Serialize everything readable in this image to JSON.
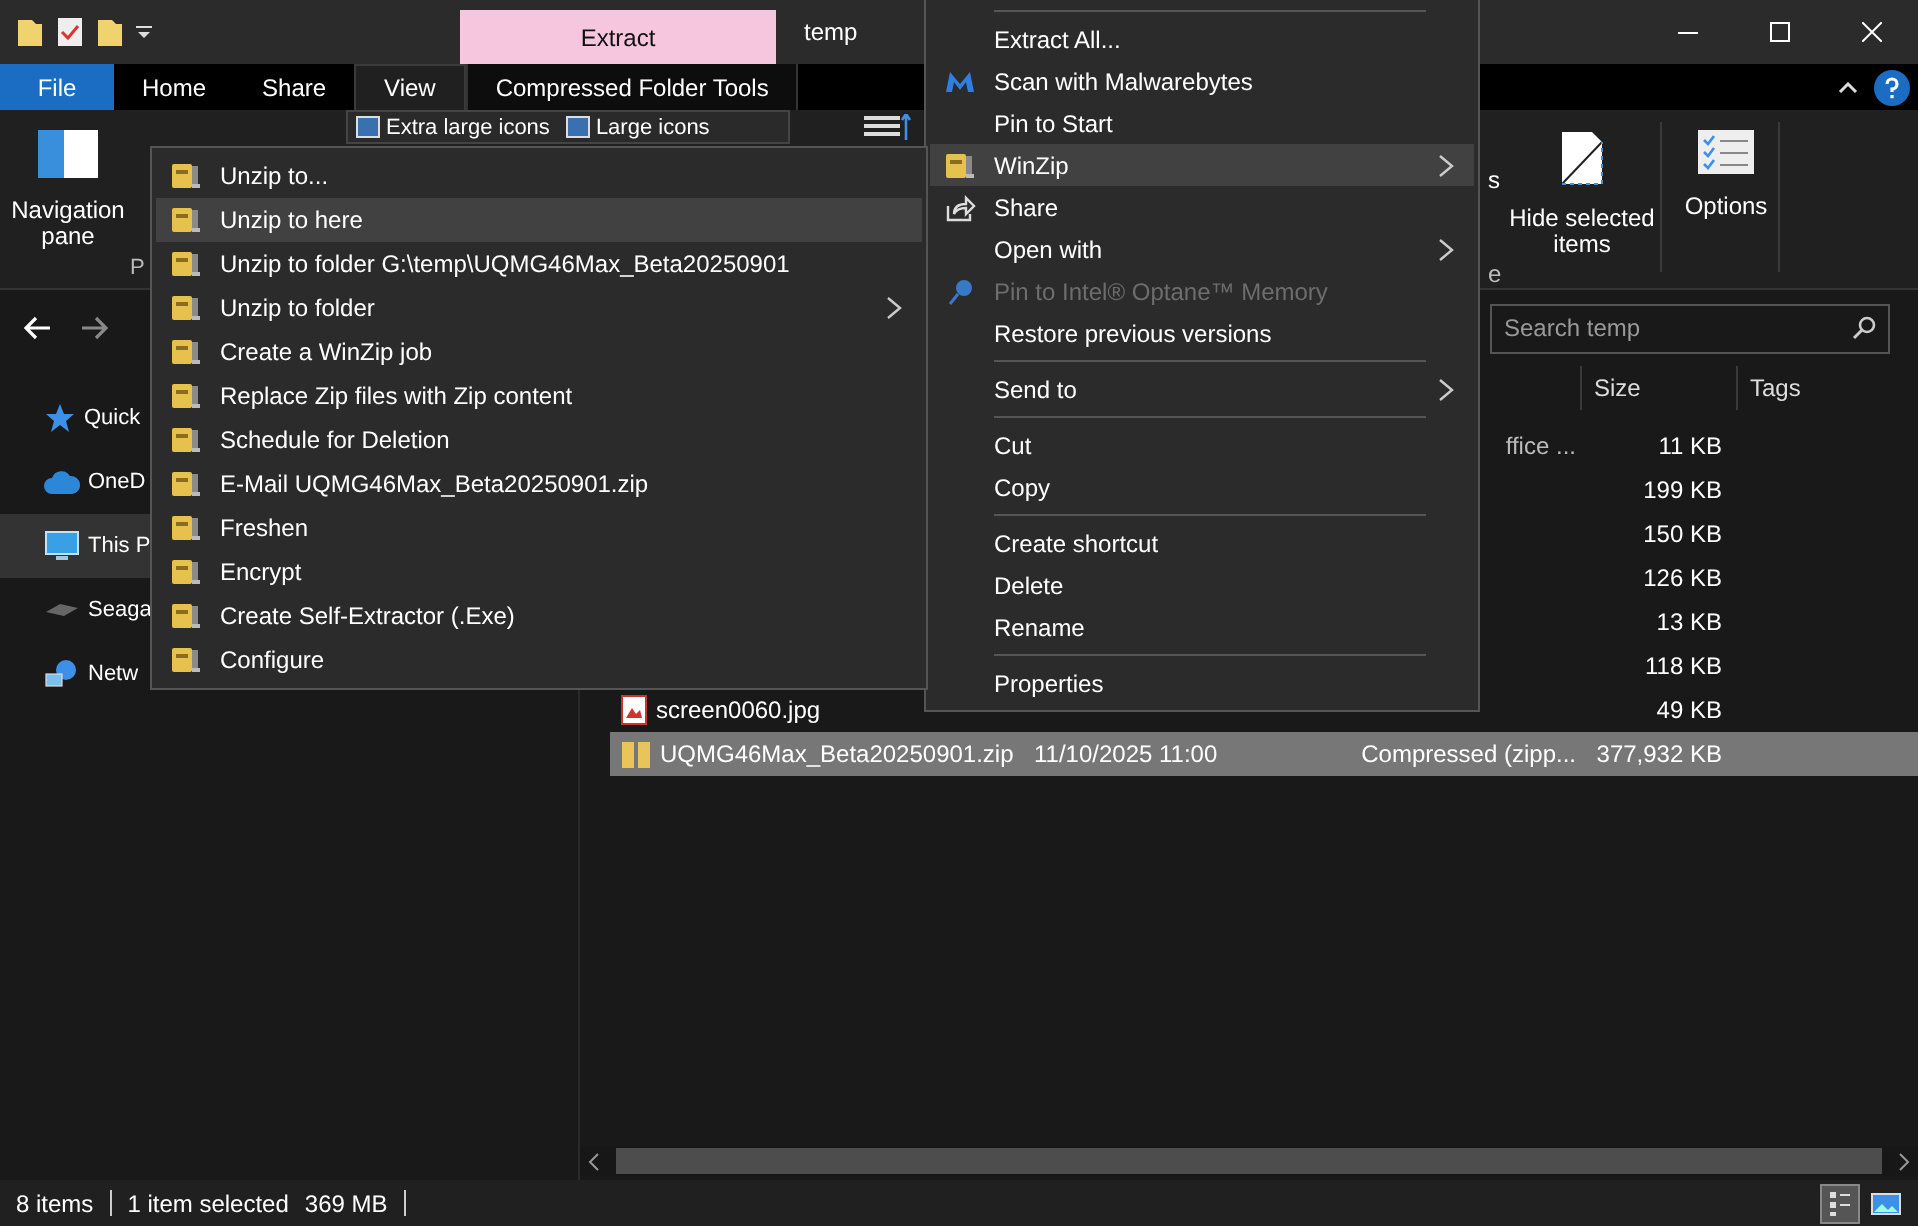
{
  "title_bar": {
    "context_tab": "Extract",
    "title": "temp"
  },
  "ribbon_tabs": [
    {
      "label": "File",
      "kind": "file",
      "selected": false
    },
    {
      "label": "Home",
      "kind": "plain",
      "selected": false
    },
    {
      "label": "Share",
      "kind": "plain",
      "selected": false
    },
    {
      "label": "View",
      "kind": "plain",
      "selected": true
    },
    {
      "label": "Compressed Folder Tools",
      "kind": "context",
      "selected": false
    }
  ],
  "ribbon": {
    "navigation_pane": "Navigation pane",
    "panes_group_label": "P",
    "layout_options": [
      "Extra large icons",
      "Large icons"
    ],
    "show_hide_option_fragment": "s",
    "show_hide_group_label": "e",
    "hide_selected": "Hide selected items",
    "options": "Options"
  },
  "search": {
    "placeholder": "Search temp"
  },
  "navigation": [
    {
      "label": "Quick",
      "kind": "star",
      "selected": false
    },
    {
      "label": "OneD",
      "kind": "cloud",
      "selected": false
    },
    {
      "label": "This P",
      "kind": "pc",
      "selected": true
    },
    {
      "label": "Seaga",
      "kind": "drive",
      "selected": false
    },
    {
      "label": "Netw",
      "kind": "network",
      "selected": false
    }
  ],
  "file_list": {
    "columns": [
      "Size",
      "Tags"
    ],
    "rows": [
      {
        "kind": "hidden",
        "type": "ffice ...",
        "size": "11 KB",
        "selected": false
      },
      {
        "kind": "hidden",
        "size": "199 KB",
        "selected": false
      },
      {
        "kind": "hidden",
        "size": "150 KB",
        "selected": false
      },
      {
        "kind": "hidden",
        "size": "126 KB",
        "selected": false
      },
      {
        "kind": "hidden",
        "size": "13 KB",
        "selected": false
      },
      {
        "kind": "hidden",
        "size": "118 KB",
        "selected": false
      },
      {
        "kind": "image",
        "name": "screen0060.jpg",
        "size": "49 KB",
        "selected": false
      },
      {
        "kind": "zip",
        "name": "UQMG46Max_Beta20250901.zip",
        "date": "11/10/2025 11:00",
        "type": "Compressed (zipp...",
        "size": "377,932 KB",
        "selected": true
      }
    ]
  },
  "status_bar": {
    "item_count": "8 items",
    "selection": "1 item selected",
    "selection_size": "369 MB"
  },
  "view_buttons": [
    {
      "kind": "details",
      "selected": true
    },
    {
      "kind": "large_icons",
      "selected": false
    }
  ],
  "context_menu": {
    "items": [
      {
        "kind": "separator"
      },
      {
        "kind": "plain",
        "label": "Extract All...",
        "selected": false,
        "disabled": false,
        "submenu": false
      },
      {
        "kind": "malwarebytes",
        "label": "Scan with Malwarebytes",
        "selected": false,
        "disabled": false,
        "submenu": false
      },
      {
        "kind": "plain",
        "label": "Pin to Start",
        "selected": false,
        "disabled": false,
        "submenu": false
      },
      {
        "kind": "winzip",
        "label": "WinZip",
        "selected": true,
        "disabled": false,
        "submenu": true
      },
      {
        "kind": "share",
        "label": "Share",
        "selected": false,
        "disabled": false,
        "submenu": false
      },
      {
        "kind": "plain",
        "label": "Open with",
        "selected": false,
        "disabled": false,
        "submenu": true
      },
      {
        "kind": "optane",
        "label": "Pin to Intel® Optane™ Memory",
        "selected": false,
        "disabled": true,
        "submenu": false
      },
      {
        "kind": "plain",
        "label": "Restore previous versions",
        "selected": false,
        "disabled": false,
        "submenu": false
      },
      {
        "kind": "separator"
      },
      {
        "kind": "plain",
        "label": "Send to",
        "selected": false,
        "disabled": false,
        "submenu": true
      },
      {
        "kind": "separator"
      },
      {
        "kind": "plain",
        "label": "Cut",
        "selected": false,
        "disabled": false,
        "submenu": false
      },
      {
        "kind": "plain",
        "label": "Copy",
        "selected": false,
        "disabled": false,
        "submenu": false
      },
      {
        "kind": "separator"
      },
      {
        "kind": "plain",
        "label": "Create shortcut",
        "selected": false,
        "disabled": false,
        "submenu": false
      },
      {
        "kind": "plain",
        "label": "Delete",
        "selected": false,
        "disabled": false,
        "submenu": false
      },
      {
        "kind": "plain",
        "label": "Rename",
        "selected": false,
        "disabled": false,
        "submenu": false
      },
      {
        "kind": "separator"
      },
      {
        "kind": "plain",
        "label": "Properties",
        "selected": false,
        "disabled": false,
        "submenu": false
      }
    ]
  },
  "winzip_submenu": {
    "items": [
      {
        "kind": "winzip",
        "label": "Unzip to...",
        "selected": false,
        "submenu": false
      },
      {
        "kind": "winzip",
        "label": "Unzip to here",
        "selected": true,
        "submenu": false
      },
      {
        "kind": "winzip",
        "label": "Unzip to folder G:\\temp\\UQMG46Max_Beta20250901",
        "selected": false,
        "submenu": false
      },
      {
        "kind": "winzip",
        "label": "Unzip to folder",
        "selected": false,
        "submenu": true
      },
      {
        "kind": "winzip",
        "label": "Create a WinZip job",
        "selected": false,
        "submenu": false
      },
      {
        "kind": "winzip",
        "label": "Replace Zip files with Zip content",
        "selected": false,
        "submenu": false
      },
      {
        "kind": "winzip",
        "label": "Schedule for Deletion",
        "selected": false,
        "submenu": false
      },
      {
        "kind": "winzip",
        "label": "E-Mail UQMG46Max_Beta20250901.zip",
        "selected": false,
        "submenu": false
      },
      {
        "kind": "winzip",
        "label": "Freshen",
        "selected": false,
        "submenu": false
      },
      {
        "kind": "winzip",
        "label": "Encrypt",
        "selected": false,
        "submenu": false
      },
      {
        "kind": "winzip",
        "label": "Create Self-Extractor (.Exe)",
        "selected": false,
        "submenu": false
      },
      {
        "kind": "winzip",
        "label": "Configure",
        "selected": false,
        "submenu": false
      }
    ]
  }
}
